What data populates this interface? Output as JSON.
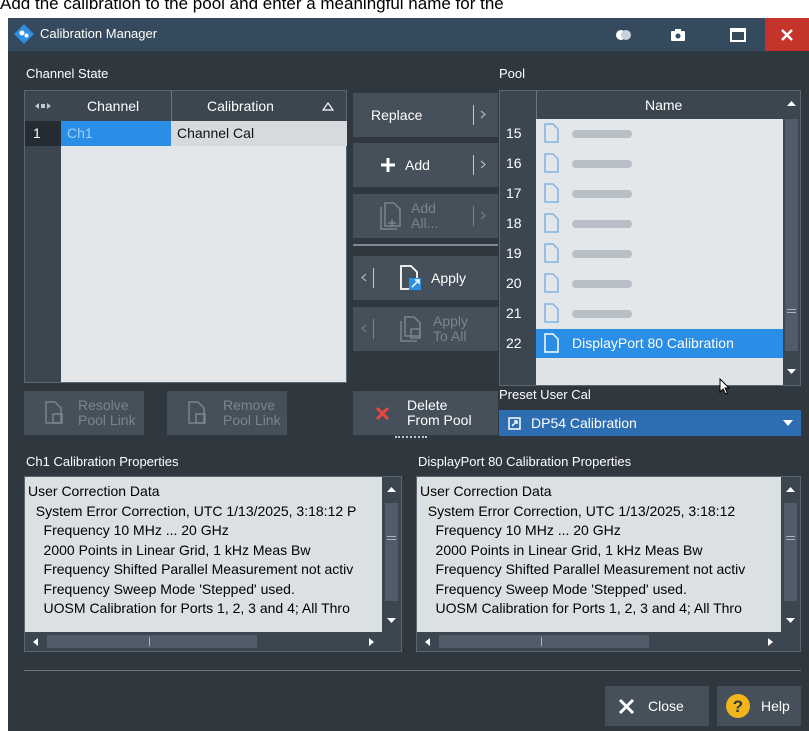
{
  "caption": "Add the calibration to the pool and enter a meaningful name for the",
  "window": {
    "title": "Calibration Manager"
  },
  "channel_state": {
    "label": "Channel State",
    "columns": [
      "Channel",
      "Calibration"
    ],
    "rows": [
      {
        "num": "1",
        "channel": "Ch1",
        "calibration": "Channel Cal"
      }
    ]
  },
  "middle": {
    "replace": "Replace",
    "add": "Add",
    "add_all_line1": "Add",
    "add_all_line2": "All...",
    "apply": "Apply",
    "apply_all_line1": "Apply",
    "apply_all_line2": "To All",
    "delete_line1": "Delete",
    "delete_line2": "From Pool"
  },
  "pool": {
    "label": "Pool",
    "column": "Name",
    "rows": [
      {
        "num": "15",
        "name": ""
      },
      {
        "num": "16",
        "name": ""
      },
      {
        "num": "17",
        "name": ""
      },
      {
        "num": "18",
        "name": ""
      },
      {
        "num": "19",
        "name": ""
      },
      {
        "num": "20",
        "name": ""
      },
      {
        "num": "21",
        "name": ""
      },
      {
        "num": "22",
        "name": "DisplayPort 80 Calibration"
      }
    ]
  },
  "preset": {
    "label": "Preset User Cal",
    "value": "DP54 Calibration"
  },
  "bottom_buttons": {
    "resolve_line1": "Resolve",
    "resolve_line2": "Pool Link",
    "remove_line1": "Remove",
    "remove_line2": "Pool Link"
  },
  "ch1_props": {
    "label": "Ch1 Calibration Properties",
    "lines": [
      "User Correction Data",
      "  System Error Correction, UTC 1/13/2025, 3:18:12 P",
      "    Frequency 10 MHz ... 20 GHz",
      "    2000 Points in Linear Grid, 1 kHz Meas Bw",
      "    Frequency Shifted Parallel Measurement not activ",
      "    Frequency Sweep Mode 'Stepped' used.",
      "    UOSM Calibration for Ports 1, 2, 3 and 4; All Thro"
    ]
  },
  "dp_props": {
    "label": "DisplayPort 80 Calibration Properties",
    "lines": [
      "User Correction Data",
      "  System Error Correction, UTC 1/13/2025, 3:18:12",
      "    Frequency 10 MHz ... 20 GHz",
      "    2000 Points in Linear Grid, 1 kHz Meas Bw",
      "    Frequency Shifted Parallel Measurement not activ",
      "    Frequency Sweep Mode 'Stepped' used.",
      "    UOSM Calibration for Ports 1, 2, 3 and 4; All Thro"
    ]
  },
  "footer": {
    "close": "Close",
    "help": "Help"
  }
}
